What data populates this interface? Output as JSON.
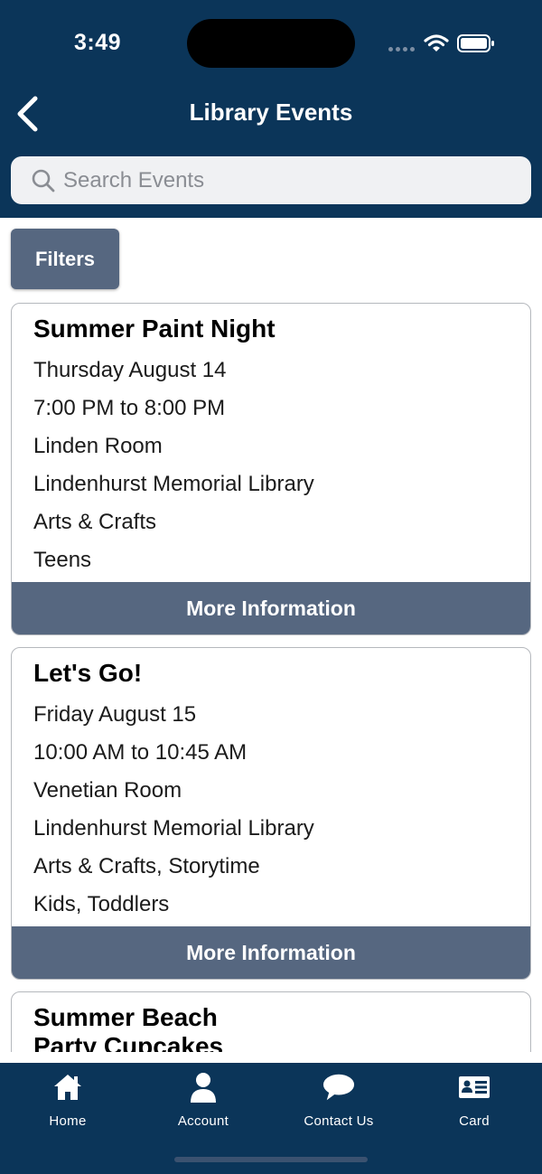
{
  "status": {
    "time": "3:49"
  },
  "header": {
    "title": "Library Events"
  },
  "search": {
    "placeholder": "Search Events"
  },
  "filters_label": "Filters",
  "events": [
    {
      "title": "Summer Paint Night",
      "date": "Thursday August 14",
      "time": "7:00 PM to 8:00 PM",
      "room": "Linden Room",
      "location": "Lindenhurst Memorial Library",
      "category": "Arts & Crafts",
      "audience": "Teens",
      "button": "More Information"
    },
    {
      "title": "Let's Go!",
      "date": "Friday August 15",
      "time": "10:00 AM to 10:45 AM",
      "room": "Venetian Room",
      "location": "Lindenhurst Memorial Library",
      "category": "Arts & Crafts, Storytime",
      "audience": "Kids, Toddlers",
      "button": "More Information"
    },
    {
      "title_line1": "Summer Beach",
      "title_line2": "Party Cupcakes"
    }
  ],
  "tabs": [
    {
      "label": "Home",
      "icon": "home-icon"
    },
    {
      "label": "Account",
      "icon": "account-icon"
    },
    {
      "label": "Contact Us",
      "icon": "chat-bubble-icon"
    },
    {
      "label": "Card",
      "icon": "library-card-icon"
    }
  ],
  "colors": {
    "header_bg": "#0b3559",
    "button_bg": "#566780",
    "search_bg": "#f0f1f3"
  }
}
